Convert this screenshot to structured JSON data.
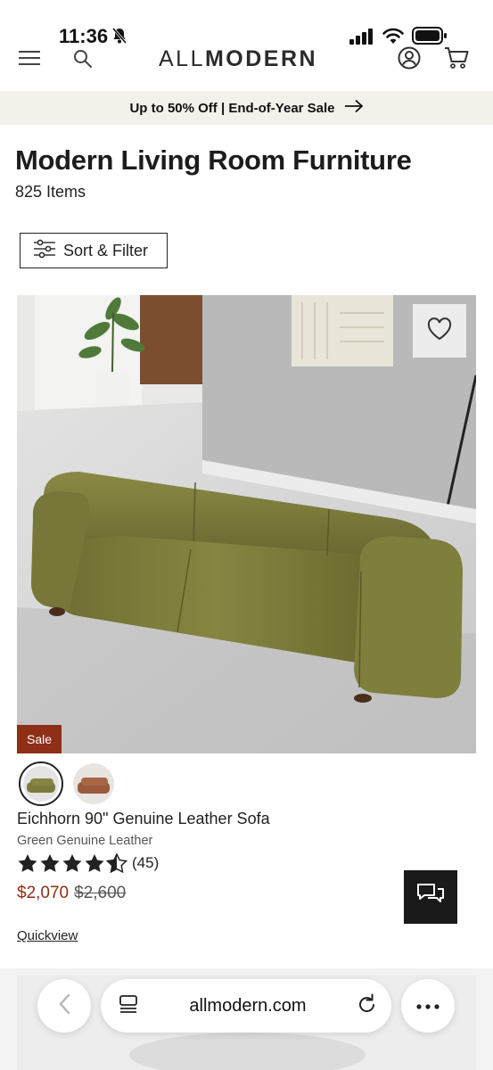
{
  "status_bar": {
    "time": "11:36",
    "icons": [
      "bell-slash-icon",
      "signal-icon",
      "wifi-icon",
      "battery-icon"
    ]
  },
  "header": {
    "logo_thin": "ALL",
    "logo_bold": "MODERN",
    "icons": [
      "menu-icon",
      "search-icon",
      "account-icon",
      "cart-icon"
    ]
  },
  "promo": {
    "text": "Up to 50% Off | End-of-Year Sale",
    "icon": "arrow-right-icon"
  },
  "page": {
    "title": "Modern Living Room Furniture",
    "item_count": "825 Items",
    "sort_filter_label": "Sort & Filter"
  },
  "product": {
    "badge": "Sale",
    "name": "Eichhorn 90\" Genuine Leather Sofa",
    "variant": "Green Genuine Leather",
    "rating": 4.5,
    "review_count": "(45)",
    "sale_price": "$2,070",
    "original_price": "$2,600",
    "quickview_label": "Quickview",
    "swatches": [
      "green",
      "brown"
    ],
    "colors": {
      "sofa": "#7a7a3c",
      "sale_badge": "#8e2f17",
      "sale_price": "#8e2f17"
    }
  },
  "browser": {
    "url": "allmodern.com",
    "icons": [
      "back-chevron-icon",
      "tabs-icon",
      "reload-icon",
      "more-icon"
    ]
  }
}
